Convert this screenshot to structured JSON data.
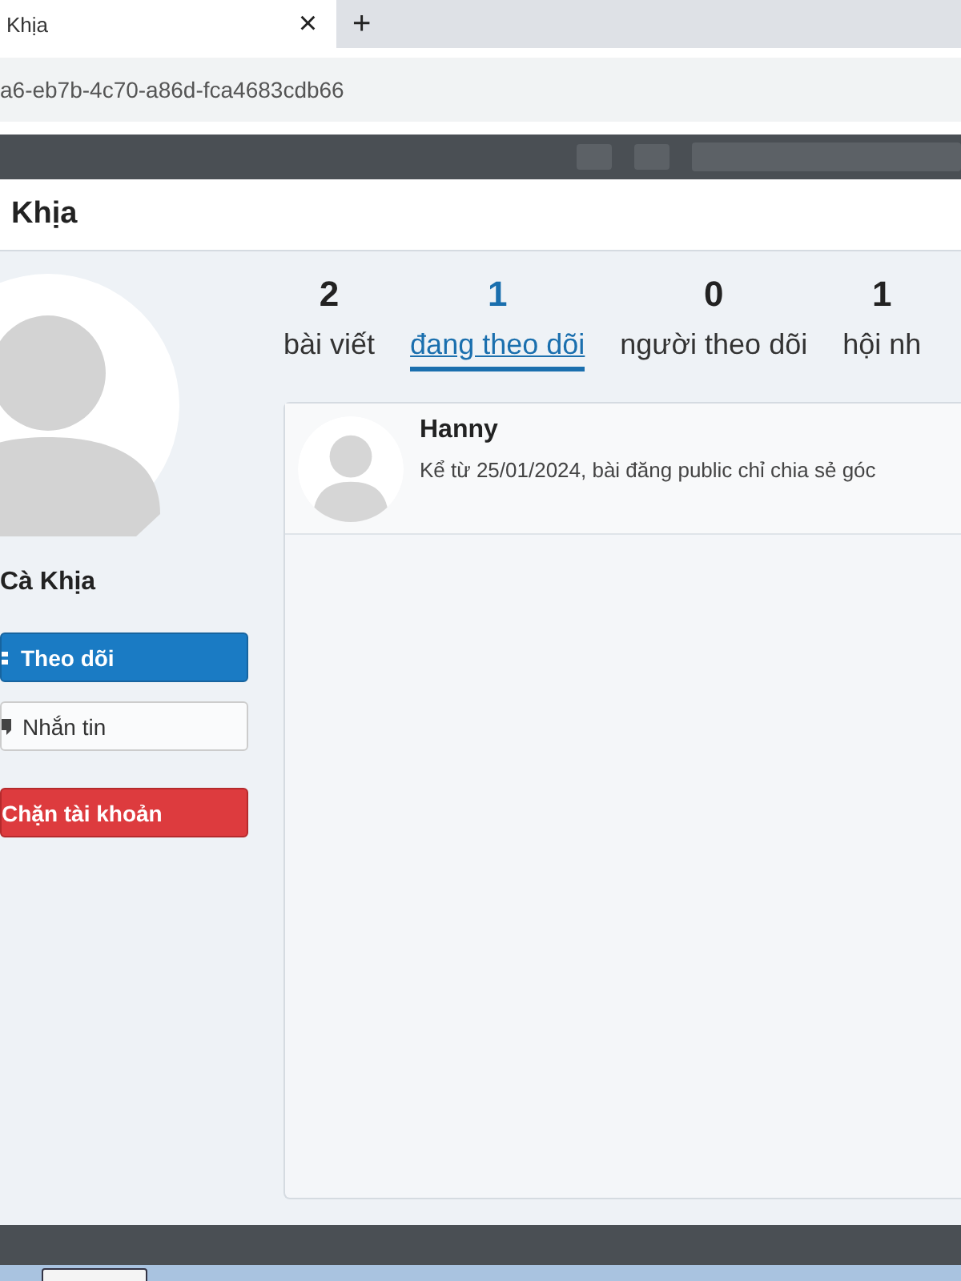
{
  "browser": {
    "tab_title": "Khịa",
    "close": "×",
    "new_tab": "+",
    "address": "a6-eb7b-4c70-a86d-fca4683cdb66"
  },
  "modal": {
    "title": "Khịa"
  },
  "profile": {
    "name": "Cà Khịa",
    "buttons": [
      {
        "kind": "primary",
        "label": "Theo dõi"
      },
      {
        "kind": "secondary",
        "label": "Nhắn tin"
      },
      {
        "kind": "danger",
        "label": "Chặn tài khoản"
      }
    ]
  },
  "stats": [
    {
      "count": "2",
      "label": "bài viết",
      "selected": false
    },
    {
      "count": "1",
      "label": "đang theo dõi",
      "selected": true
    },
    {
      "count": "0",
      "label": "người theo dõi",
      "selected": false
    },
    {
      "count": "1",
      "label": "hội nh",
      "selected": false
    }
  ],
  "following": [
    {
      "name": "Hanny",
      "bio": "Kể từ 25/01/2024, bài đăng public chỉ chia sẻ góc"
    }
  ]
}
